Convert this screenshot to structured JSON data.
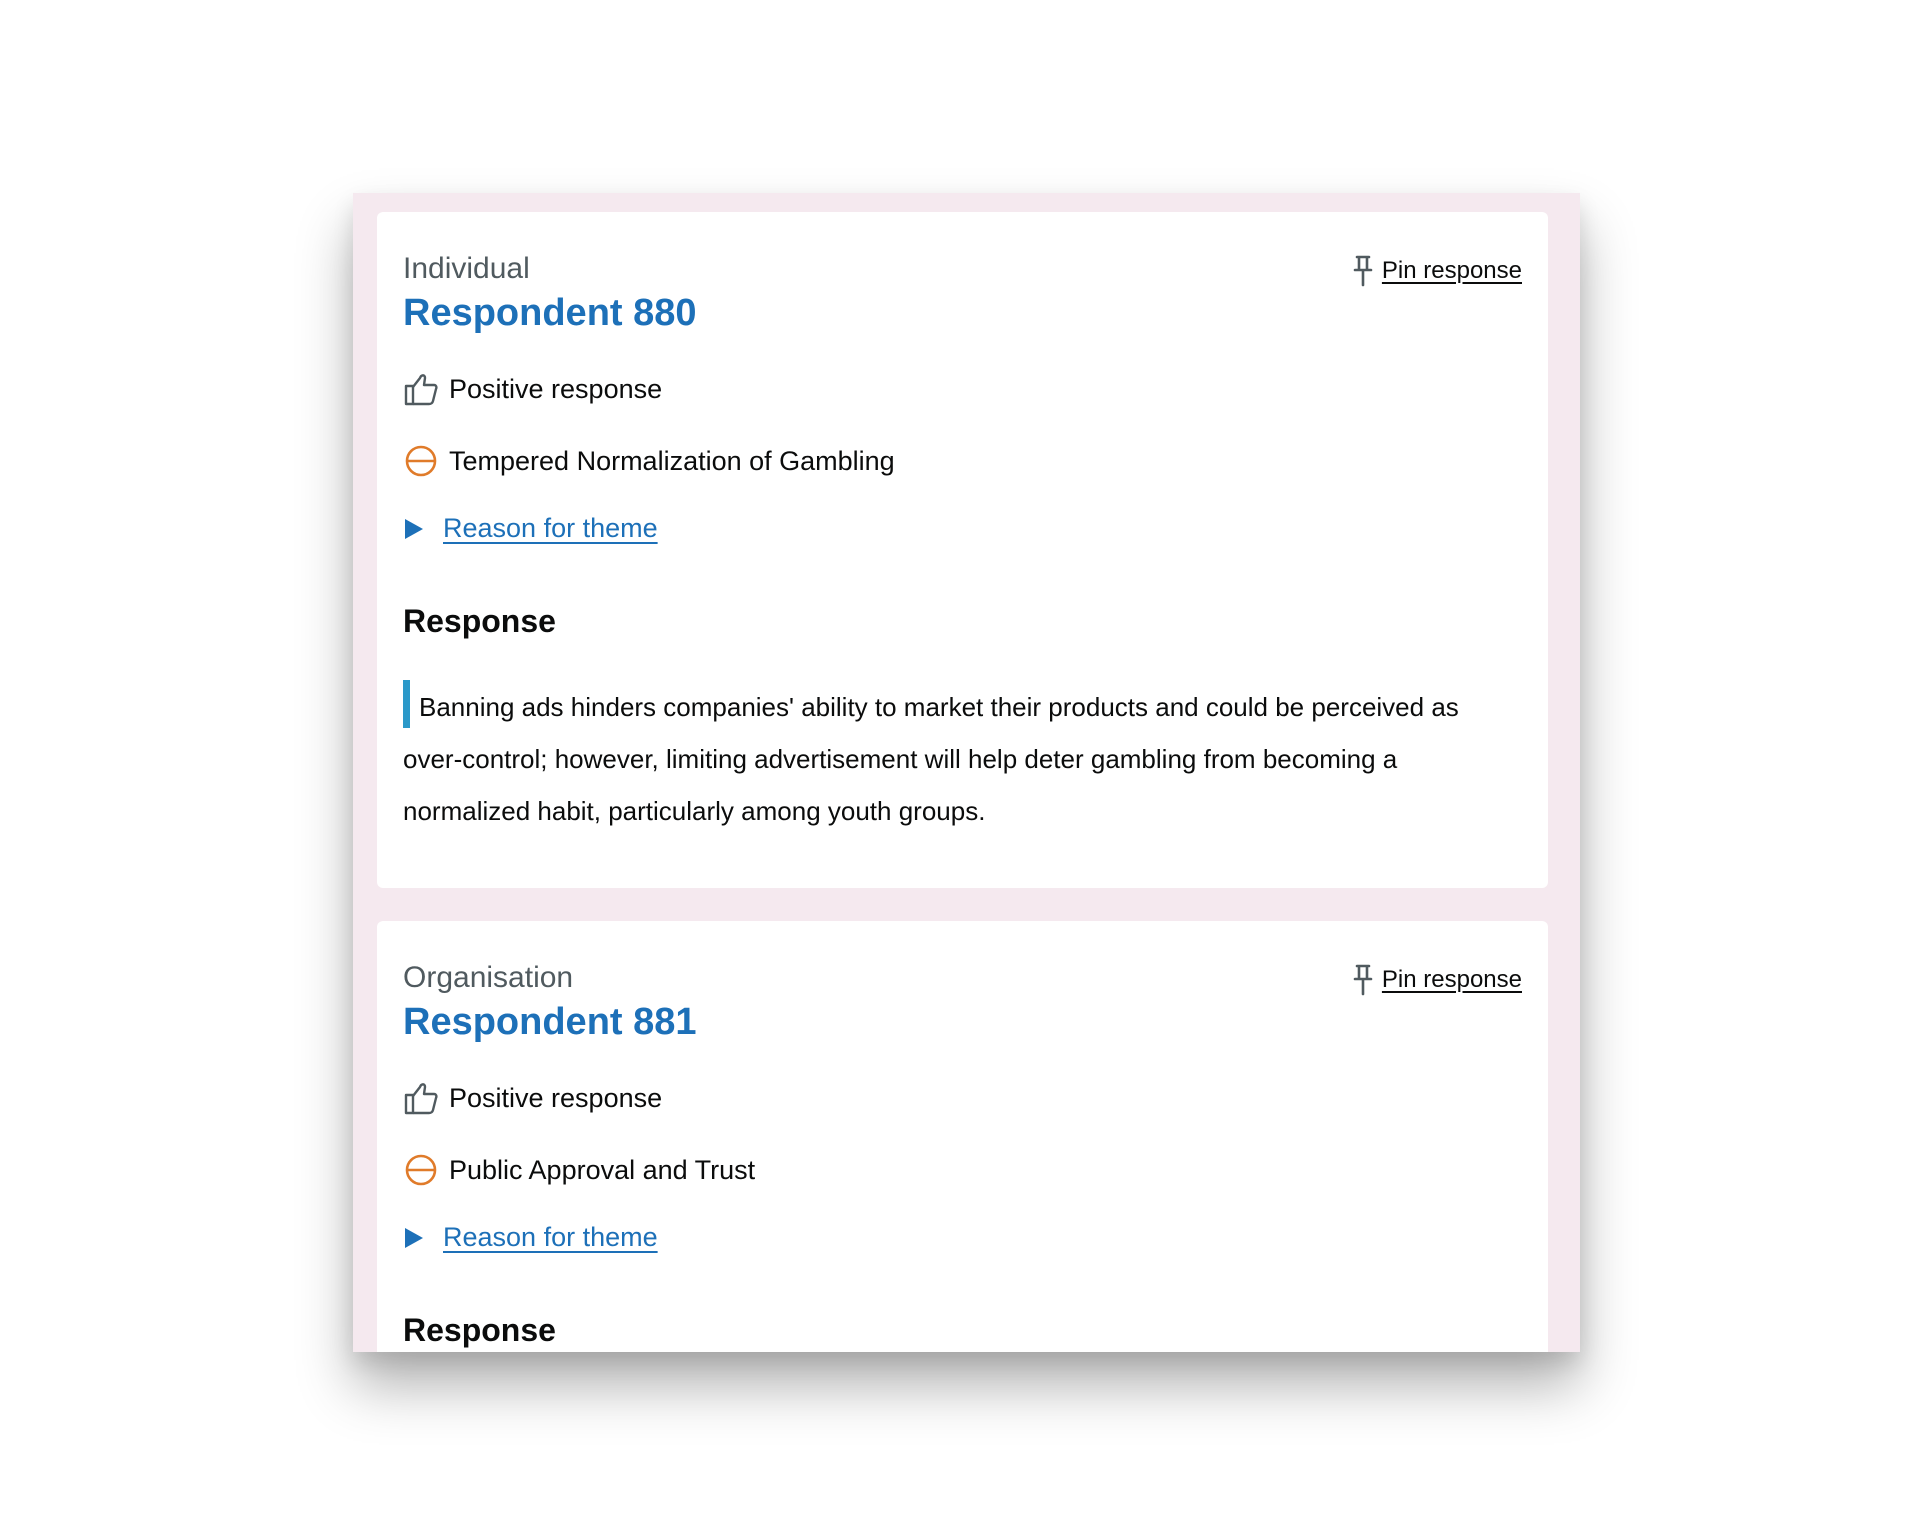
{
  "responses": [
    {
      "respondent_type": "Individual",
      "title": "Respondent 880",
      "pin_label": "Pin response",
      "sentiment": "Positive response",
      "theme": "Tempered Normalization of Gambling",
      "reason_link": "Reason for theme",
      "response_heading": "Response",
      "response_text": "Banning ads hinders companies' ability to market their products and could be perceived as over-control; however, limiting advertisement will help deter gambling from becoming a normalized habit, particularly among youth groups."
    },
    {
      "respondent_type": "Organisation",
      "title": "Respondent 881",
      "pin_label": "Pin response",
      "sentiment": "Positive response",
      "theme": "Public Approval and Trust",
      "reason_link": "Reason for theme",
      "response_heading": "Response"
    }
  ],
  "icons": {
    "pin": "pushpin-icon",
    "sentiment": "thumbs-up-icon",
    "theme": "circle-minus-icon",
    "disclosure": "triangle-right-icon"
  },
  "colors": {
    "link": "#1d70b8",
    "theme_icon": "#e07b2a",
    "quote_bar": "#2b99c9",
    "panel_background": "#f5e9ef"
  }
}
